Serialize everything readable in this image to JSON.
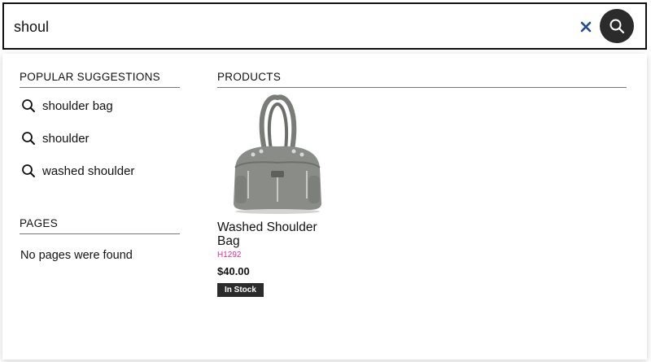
{
  "search": {
    "value": "shoul",
    "placeholder": ""
  },
  "colors": {
    "accent_clear": "#1f4e8c",
    "sku_color": "#e0309a",
    "badge_bg": "#2b2b2b"
  },
  "suggestions": {
    "heading": "POPULAR SUGGESTIONS",
    "items": [
      {
        "label": "shoulder bag",
        "icon": "search-icon"
      },
      {
        "label": "shoulder",
        "icon": "search-icon"
      },
      {
        "label": "washed shoulder",
        "icon": "search-icon"
      }
    ]
  },
  "pages": {
    "heading": "PAGES",
    "empty_text": "No pages were found"
  },
  "products": {
    "heading": "PRODUCTS",
    "items": [
      {
        "name": "Washed Shoulder Bag",
        "sku": "H1292",
        "price": "$40.00",
        "stock": "In Stock",
        "image": "gray-shoulder-bag"
      }
    ]
  }
}
